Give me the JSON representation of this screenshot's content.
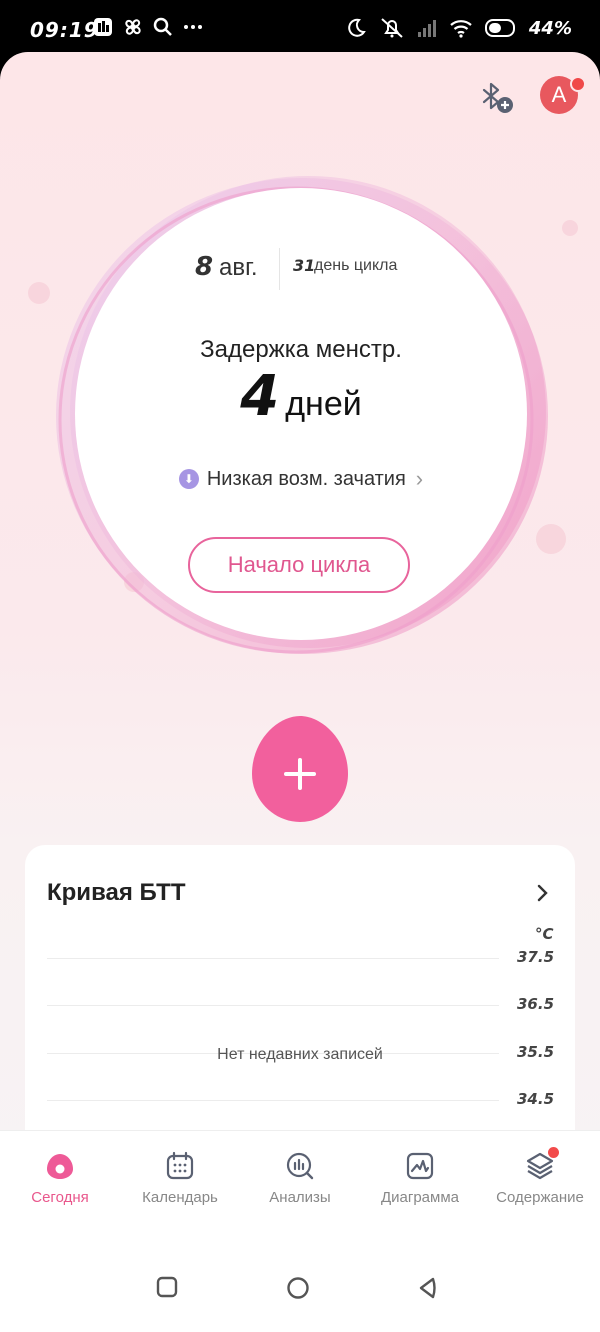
{
  "status_bar": {
    "time": "09:19",
    "battery": "44%"
  },
  "header": {
    "avatar_letter": "A"
  },
  "cycle": {
    "date_day": "8",
    "date_month": "авг.",
    "cycle_day": "31",
    "cycle_day_label": "день цикла",
    "delay_label": "Задержка менстр.",
    "delay_value": "4",
    "delay_unit": "дней",
    "conception_chance": "Низкая возм. зачатия",
    "start_button": "Начало цикла"
  },
  "colors": {
    "accent": "#EE5A97",
    "avatar": "#E8585E",
    "notification": "#F24B4B",
    "chance_icon": "#A695E3"
  },
  "bbt_card": {
    "title": "Кривая БТТ",
    "unit": "°C",
    "empty_text": "Нет недавних записей",
    "y_ticks": [
      "37.5",
      "36.5",
      "35.5",
      "34.5"
    ]
  },
  "tabs": [
    {
      "label": "Сегодня",
      "icon": "drop-icon",
      "active": true
    },
    {
      "label": "Календарь",
      "icon": "calendar-icon",
      "active": false
    },
    {
      "label": "Анализы",
      "icon": "analysis-icon",
      "active": false
    },
    {
      "label": "Диаграмма",
      "icon": "chart-icon",
      "active": false
    },
    {
      "label": "Содержание",
      "icon": "layers-icon",
      "active": false,
      "badge": true
    }
  ],
  "system_nav": {
    "buttons": [
      "recents",
      "home",
      "back"
    ]
  }
}
